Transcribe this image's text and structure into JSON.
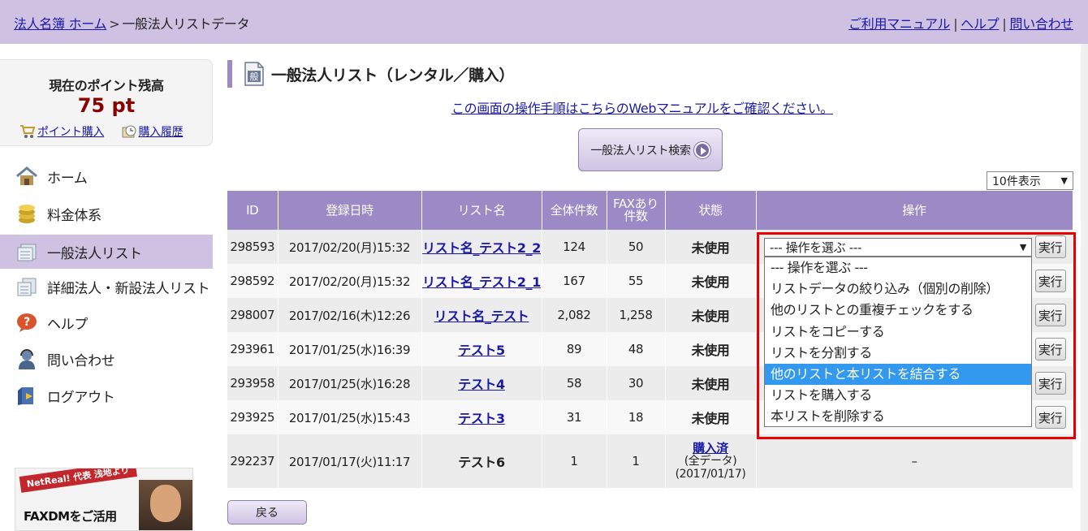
{
  "header": {
    "breadcrumb_home": "法人名簿 ホーム",
    "breadcrumb_sep": ">",
    "breadcrumb_current": "一般法人リストデータ",
    "links": [
      "ご利用マニュアル",
      "ヘルプ",
      "問い合わせ"
    ],
    "link_sep": "|"
  },
  "points": {
    "title": "現在のポイント残高",
    "value": "75 pt",
    "buy_label": "ポイント購入",
    "history_label": "購入履歴"
  },
  "sidebar": {
    "items": [
      {
        "label": "ホーム",
        "icon": "house-icon"
      },
      {
        "label": "料金体系",
        "icon": "coins-icon"
      },
      {
        "label": "一般法人リスト",
        "icon": "list-icon",
        "active": true
      },
      {
        "label": "詳細法人・新設法人リスト",
        "icon": "detail-list-icon"
      },
      {
        "label": "ヘルプ",
        "icon": "help-icon"
      },
      {
        "label": "問い合わせ",
        "icon": "support-icon"
      },
      {
        "label": "ログアウト",
        "icon": "logout-icon"
      }
    ]
  },
  "banner": {
    "tag": "NetReal! 代表 浅地より",
    "text": "FAXDMをご活用"
  },
  "main": {
    "title_icon_text": "般",
    "title": "一般法人リスト（レンタル／購入）",
    "manual_link": "この画面の操作手順はこちらのWebマニュアルをご確認ください。",
    "search_button": "一般法人リスト検索",
    "per_page": "10件表示",
    "back_button": "戻る"
  },
  "table": {
    "headers": [
      "ID",
      "登録日時",
      "リスト名",
      "全体件数",
      "FAXあり件数",
      "状態",
      "操作"
    ],
    "fax_header_line1": "FAXあり",
    "fax_header_line2": "件数",
    "exec_label": "実行",
    "rows": [
      {
        "id": "298593",
        "date": "2017/02/20(月)15:32",
        "name": "リスト名_テスト2_2",
        "total": "124",
        "fax": "50",
        "status": "未使用"
      },
      {
        "id": "298592",
        "date": "2017/02/20(月)15:32",
        "name": "リスト名_テスト2_1",
        "total": "167",
        "fax": "55",
        "status": "未使用"
      },
      {
        "id": "298007",
        "date": "2017/02/16(木)12:26",
        "name": "リスト名_テスト",
        "total": "2,082",
        "fax": "1,258",
        "status": "未使用"
      },
      {
        "id": "293961",
        "date": "2017/01/25(水)16:39",
        "name": "テスト5",
        "total": "89",
        "fax": "48",
        "status": "未使用"
      },
      {
        "id": "293958",
        "date": "2017/01/25(水)16:28",
        "name": "テスト4",
        "total": "58",
        "fax": "30",
        "status": "未使用"
      },
      {
        "id": "293925",
        "date": "2017/01/25(水)15:43",
        "name": "テスト3",
        "total": "31",
        "fax": "18",
        "status": "未使用"
      }
    ],
    "last_row": {
      "id": "292237",
      "date": "2017/01/17(火)11:17",
      "name": "テスト6",
      "total": "1",
      "fax": "1",
      "status_link": "購入済",
      "status_sub": "(全データ)",
      "status_date": "(2017/01/17)",
      "op": "–"
    }
  },
  "dropdown": {
    "selected": "--- 操作を選ぶ ---",
    "options": [
      "--- 操作を選ぶ ---",
      "リストデータの絞り込み（個別の削除）",
      "他のリストとの重複チェックをする",
      "リストをコピーする",
      "リストを分割する",
      "他のリストと本リストを結合する",
      "リストを購入する",
      "本リストを削除する"
    ],
    "highlighted_index": 5
  },
  "colors": {
    "header_bg": "#cfc1e2",
    "table_header": "#9b8ac6",
    "highlight_border": "#e60000",
    "option_selected": "#3399ee",
    "points_value": "#8b0000"
  }
}
